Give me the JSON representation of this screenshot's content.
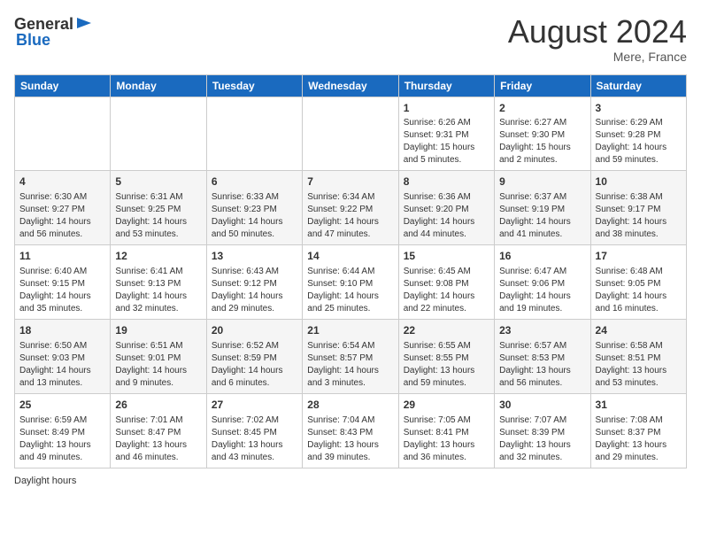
{
  "header": {
    "logo_general": "General",
    "logo_blue": "Blue",
    "month_title": "August 2024",
    "location": "Mere, France"
  },
  "days_of_week": [
    "Sunday",
    "Monday",
    "Tuesday",
    "Wednesday",
    "Thursday",
    "Friday",
    "Saturday"
  ],
  "footer": {
    "daylight_label": "Daylight hours"
  },
  "weeks": [
    [
      {
        "day": "",
        "info": ""
      },
      {
        "day": "",
        "info": ""
      },
      {
        "day": "",
        "info": ""
      },
      {
        "day": "",
        "info": ""
      },
      {
        "day": "1",
        "info": "Sunrise: 6:26 AM\nSunset: 9:31 PM\nDaylight: 15 hours\nand 5 minutes."
      },
      {
        "day": "2",
        "info": "Sunrise: 6:27 AM\nSunset: 9:30 PM\nDaylight: 15 hours\nand 2 minutes."
      },
      {
        "day": "3",
        "info": "Sunrise: 6:29 AM\nSunset: 9:28 PM\nDaylight: 14 hours\nand 59 minutes."
      }
    ],
    [
      {
        "day": "4",
        "info": "Sunrise: 6:30 AM\nSunset: 9:27 PM\nDaylight: 14 hours\nand 56 minutes."
      },
      {
        "day": "5",
        "info": "Sunrise: 6:31 AM\nSunset: 9:25 PM\nDaylight: 14 hours\nand 53 minutes."
      },
      {
        "day": "6",
        "info": "Sunrise: 6:33 AM\nSunset: 9:23 PM\nDaylight: 14 hours\nand 50 minutes."
      },
      {
        "day": "7",
        "info": "Sunrise: 6:34 AM\nSunset: 9:22 PM\nDaylight: 14 hours\nand 47 minutes."
      },
      {
        "day": "8",
        "info": "Sunrise: 6:36 AM\nSunset: 9:20 PM\nDaylight: 14 hours\nand 44 minutes."
      },
      {
        "day": "9",
        "info": "Sunrise: 6:37 AM\nSunset: 9:19 PM\nDaylight: 14 hours\nand 41 minutes."
      },
      {
        "day": "10",
        "info": "Sunrise: 6:38 AM\nSunset: 9:17 PM\nDaylight: 14 hours\nand 38 minutes."
      }
    ],
    [
      {
        "day": "11",
        "info": "Sunrise: 6:40 AM\nSunset: 9:15 PM\nDaylight: 14 hours\nand 35 minutes."
      },
      {
        "day": "12",
        "info": "Sunrise: 6:41 AM\nSunset: 9:13 PM\nDaylight: 14 hours\nand 32 minutes."
      },
      {
        "day": "13",
        "info": "Sunrise: 6:43 AM\nSunset: 9:12 PM\nDaylight: 14 hours\nand 29 minutes."
      },
      {
        "day": "14",
        "info": "Sunrise: 6:44 AM\nSunset: 9:10 PM\nDaylight: 14 hours\nand 25 minutes."
      },
      {
        "day": "15",
        "info": "Sunrise: 6:45 AM\nSunset: 9:08 PM\nDaylight: 14 hours\nand 22 minutes."
      },
      {
        "day": "16",
        "info": "Sunrise: 6:47 AM\nSunset: 9:06 PM\nDaylight: 14 hours\nand 19 minutes."
      },
      {
        "day": "17",
        "info": "Sunrise: 6:48 AM\nSunset: 9:05 PM\nDaylight: 14 hours\nand 16 minutes."
      }
    ],
    [
      {
        "day": "18",
        "info": "Sunrise: 6:50 AM\nSunset: 9:03 PM\nDaylight: 14 hours\nand 13 minutes."
      },
      {
        "day": "19",
        "info": "Sunrise: 6:51 AM\nSunset: 9:01 PM\nDaylight: 14 hours\nand 9 minutes."
      },
      {
        "day": "20",
        "info": "Sunrise: 6:52 AM\nSunset: 8:59 PM\nDaylight: 14 hours\nand 6 minutes."
      },
      {
        "day": "21",
        "info": "Sunrise: 6:54 AM\nSunset: 8:57 PM\nDaylight: 14 hours\nand 3 minutes."
      },
      {
        "day": "22",
        "info": "Sunrise: 6:55 AM\nSunset: 8:55 PM\nDaylight: 13 hours\nand 59 minutes."
      },
      {
        "day": "23",
        "info": "Sunrise: 6:57 AM\nSunset: 8:53 PM\nDaylight: 13 hours\nand 56 minutes."
      },
      {
        "day": "24",
        "info": "Sunrise: 6:58 AM\nSunset: 8:51 PM\nDaylight: 13 hours\nand 53 minutes."
      }
    ],
    [
      {
        "day": "25",
        "info": "Sunrise: 6:59 AM\nSunset: 8:49 PM\nDaylight: 13 hours\nand 49 minutes."
      },
      {
        "day": "26",
        "info": "Sunrise: 7:01 AM\nSunset: 8:47 PM\nDaylight: 13 hours\nand 46 minutes."
      },
      {
        "day": "27",
        "info": "Sunrise: 7:02 AM\nSunset: 8:45 PM\nDaylight: 13 hours\nand 43 minutes."
      },
      {
        "day": "28",
        "info": "Sunrise: 7:04 AM\nSunset: 8:43 PM\nDaylight: 13 hours\nand 39 minutes."
      },
      {
        "day": "29",
        "info": "Sunrise: 7:05 AM\nSunset: 8:41 PM\nDaylight: 13 hours\nand 36 minutes."
      },
      {
        "day": "30",
        "info": "Sunrise: 7:07 AM\nSunset: 8:39 PM\nDaylight: 13 hours\nand 32 minutes."
      },
      {
        "day": "31",
        "info": "Sunrise: 7:08 AM\nSunset: 8:37 PM\nDaylight: 13 hours\nand 29 minutes."
      }
    ]
  ]
}
